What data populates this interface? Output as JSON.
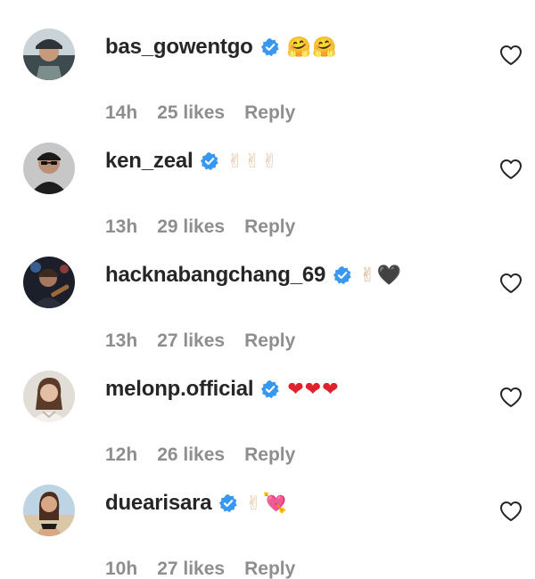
{
  "comments": [
    {
      "username": "bas_gowentgo",
      "verified": true,
      "emoji_text": "🤗🤗",
      "emoji_color": "#f5b51d",
      "time": "14h",
      "likes": "25 likes",
      "reply_label": "Reply",
      "like_icon": "heart-outline-icon"
    },
    {
      "username": "ken_zeal",
      "verified": true,
      "emoji_text": "✌✌✌",
      "emoji_color": "#e8c4a4",
      "time": "13h",
      "likes": "29 likes",
      "reply_label": "Reply",
      "like_icon": "heart-outline-icon"
    },
    {
      "username": "hacknabangchang_69",
      "verified": true,
      "emoji_text": "✌🖤",
      "emoji_color": "#d9b08c",
      "time": "13h",
      "likes": "27 likes",
      "reply_label": "Reply",
      "like_icon": "heart-outline-icon"
    },
    {
      "username": "melonp.official",
      "verified": true,
      "emoji_text": "❤❤❤",
      "emoji_color": "#e0202a",
      "time": "12h",
      "likes": "26 likes",
      "reply_label": "Reply",
      "like_icon": "heart-outline-icon"
    },
    {
      "username": "duearisara",
      "verified": true,
      "emoji_text": "✌💘",
      "emoji_color": "#e8c4a4",
      "time": "10h",
      "likes": "27 likes",
      "reply_label": "Reply",
      "like_icon": "heart-outline-icon"
    }
  ],
  "colors": {
    "username": "#262626",
    "meta": "#8e8e8e",
    "verified_badge": "#3897f0"
  }
}
